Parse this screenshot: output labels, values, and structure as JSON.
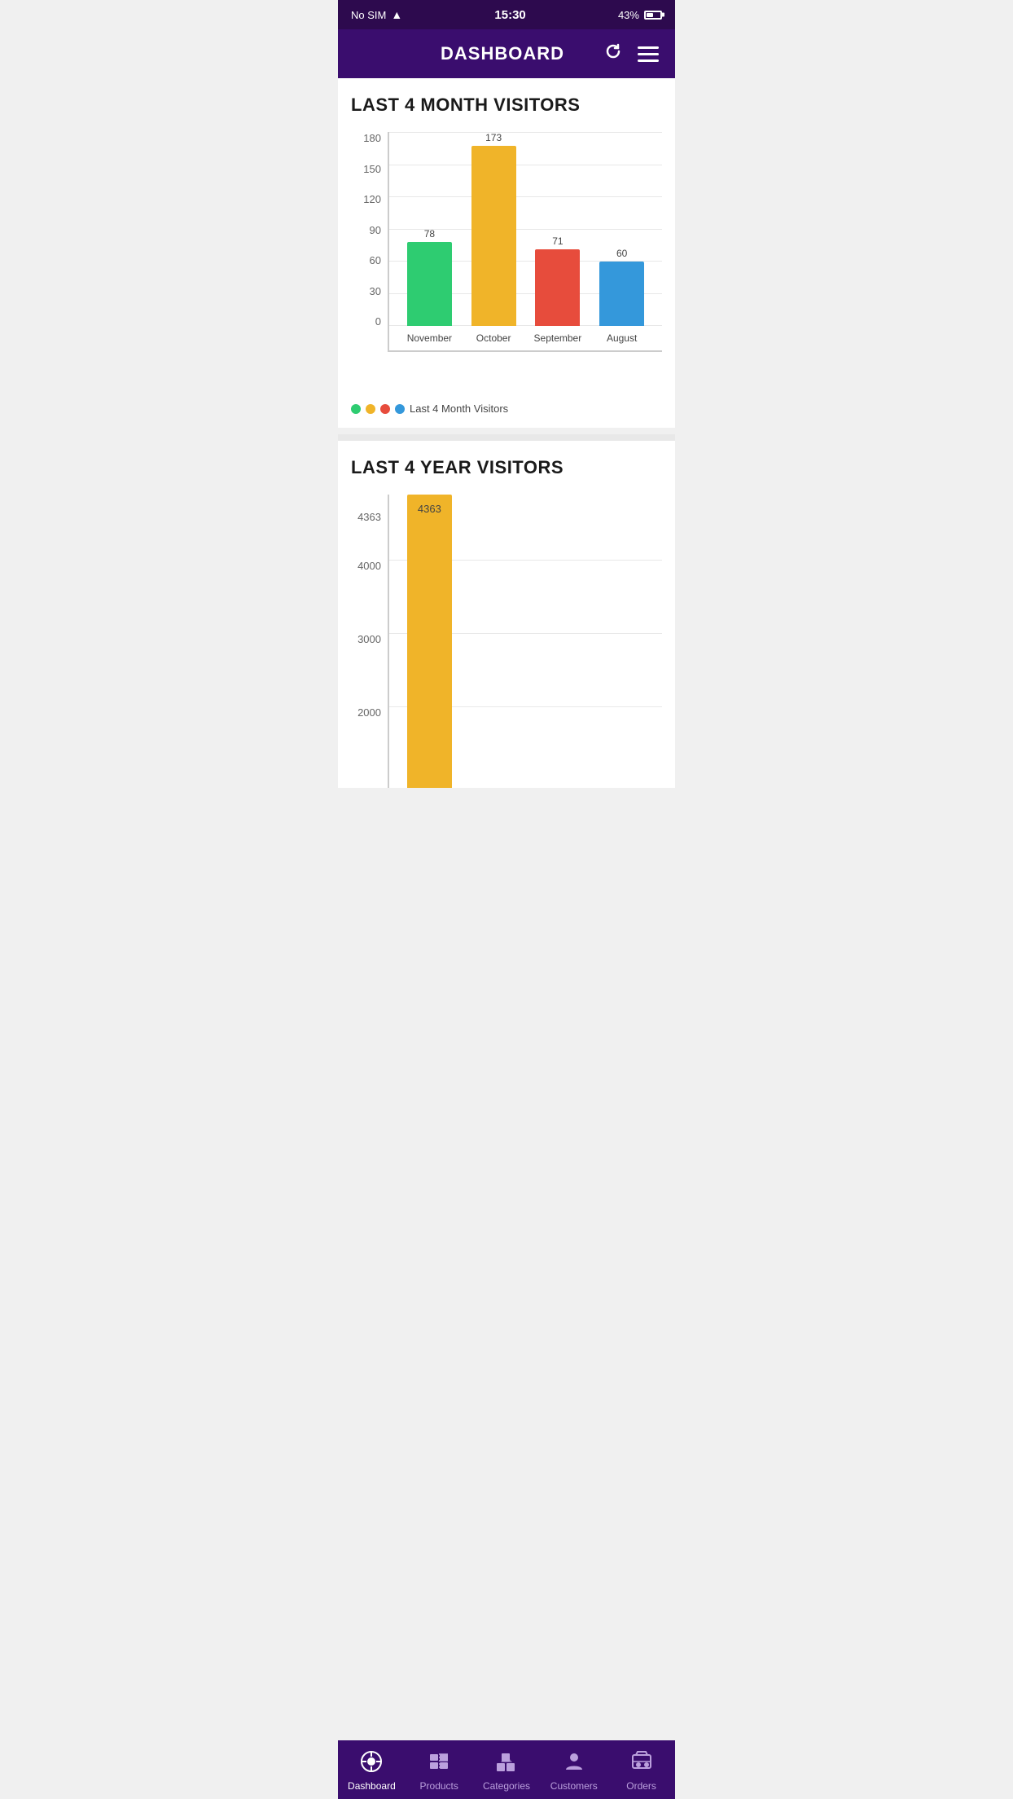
{
  "statusBar": {
    "carrier": "No SIM",
    "time": "15:30",
    "battery": "43%"
  },
  "header": {
    "title": "DASHBOARD",
    "refreshLabel": "refresh",
    "menuLabel": "menu"
  },
  "monthChart": {
    "title": "LAST 4 MONTH VISITORS",
    "yLabels": [
      "180",
      "150",
      "120",
      "90",
      "60",
      "30",
      "0"
    ],
    "bars": [
      {
        "month": "November",
        "value": 78,
        "color": "#2ecc71",
        "heightPct": 43.3
      },
      {
        "month": "October",
        "value": 173,
        "color": "#f0b429",
        "heightPct": 96.1
      },
      {
        "month": "September",
        "value": 71,
        "color": "#e74c3c",
        "heightPct": 39.4
      },
      {
        "month": "August",
        "value": 60,
        "color": "#3498db",
        "heightPct": 33.3
      }
    ],
    "legendDots": [
      {
        "color": "#2ecc71"
      },
      {
        "color": "#f0b429"
      },
      {
        "color": "#e74c3c"
      },
      {
        "color": "#3498db"
      }
    ],
    "legendLabel": "Last 4 Month Visitors",
    "maxValue": 180
  },
  "yearChart": {
    "title": "LAST 4 YEAR VISITORS",
    "visibleBar": {
      "value": 4363,
      "color": "#f0b429"
    },
    "yLabels": [
      "4000",
      "3000",
      "2000"
    ]
  },
  "bottomNav": {
    "items": [
      {
        "id": "dashboard",
        "label": "Dashboard",
        "icon": "dashboard",
        "active": true
      },
      {
        "id": "products",
        "label": "Products",
        "icon": "products",
        "active": false
      },
      {
        "id": "categories",
        "label": "Categories",
        "icon": "categories",
        "active": false
      },
      {
        "id": "customers",
        "label": "Customers",
        "icon": "customers",
        "active": false
      },
      {
        "id": "orders",
        "label": "Orders",
        "icon": "orders",
        "active": false
      }
    ]
  }
}
